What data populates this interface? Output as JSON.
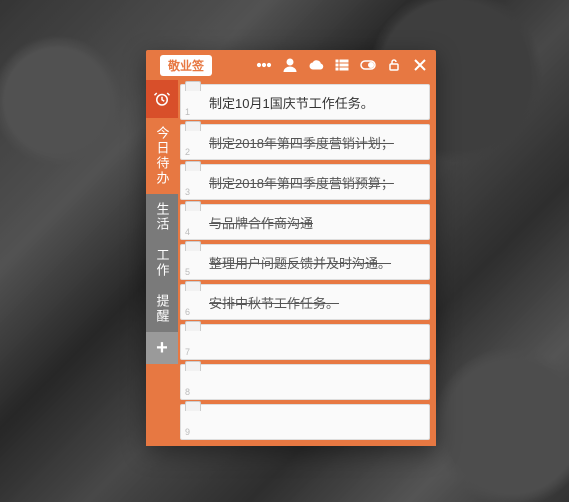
{
  "header": {
    "brand": "敬业签"
  },
  "sidebar": {
    "items": [
      {
        "label": "今日待办",
        "style": "active"
      },
      {
        "label": "生活",
        "style": "dim"
      },
      {
        "label": "工作",
        "style": "dim"
      },
      {
        "label": "提醒",
        "style": "dim"
      }
    ]
  },
  "tasks": [
    {
      "n": "1",
      "text": "制定10月1国庆节工作任务。",
      "done": false
    },
    {
      "n": "2",
      "text": "制定2018年第四季度营销计划；",
      "done": true
    },
    {
      "n": "3",
      "text": "制定2018年第四季度营销预算；",
      "done": true
    },
    {
      "n": "4",
      "text": "与品牌合作商沟通",
      "done": true
    },
    {
      "n": "5",
      "text": "整理用户问题反馈并及时沟通。",
      "done": true
    },
    {
      "n": "6",
      "text": "安排中秋节工作任务。",
      "done": true
    },
    {
      "n": "7",
      "text": "",
      "done": false
    },
    {
      "n": "8",
      "text": "",
      "done": false
    },
    {
      "n": "9",
      "text": "",
      "done": false
    }
  ]
}
